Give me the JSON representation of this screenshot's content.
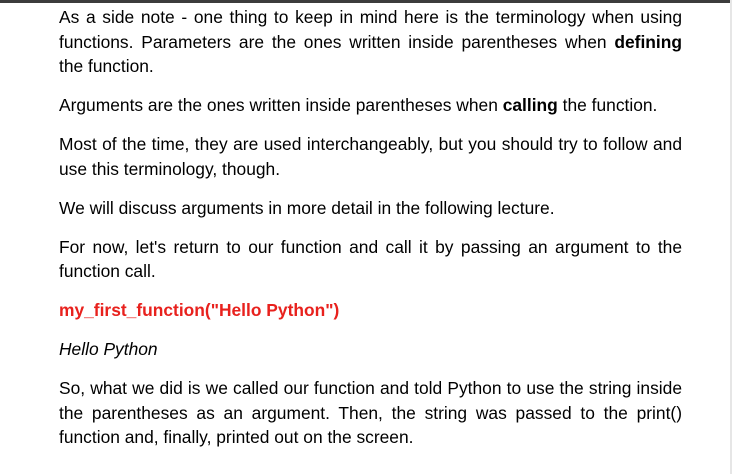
{
  "document": {
    "para1": {
      "before": "As a side note - one thing to keep in mind here is the terminology when using functions. Parameters are the ones written inside parentheses when ",
      "bold": "defining",
      "after": " the function."
    },
    "para2": {
      "before": "Arguments are the ones written inside parentheses when ",
      "bold": "calling",
      "after": " the function."
    },
    "para3": "Most of the time, they are used interchangeably, but you should try to follow and use this terminology, though.",
    "para4": "We will discuss arguments in more detail in the following lecture.",
    "para5": "For now, let's return to our function and call it by passing an argument to the function call.",
    "code_line": "my_first_function(\"Hello Python\")",
    "output_line": "Hello Python",
    "para6": "So, what we did is we called our function and told Python to use the string inside the parentheses as an argument. Then, the string was passed to the print() function and, finally, printed out on the screen."
  },
  "colors": {
    "code_text": "#e8211d",
    "body_text": "#000000",
    "top_rule": "#3c3c3c"
  }
}
